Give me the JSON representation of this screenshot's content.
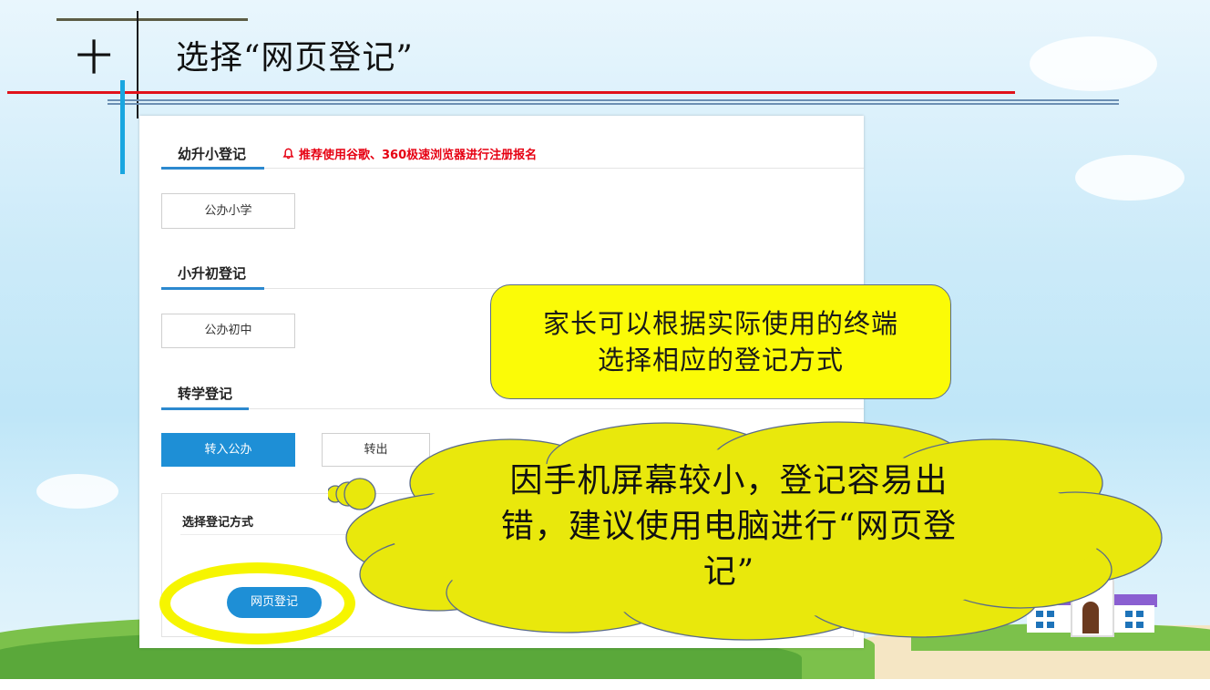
{
  "header": {
    "number": "十",
    "title": "选择“网页登记”"
  },
  "panel": {
    "sections": [
      {
        "title": "幼升小登记",
        "buttons": [
          "公办小学"
        ]
      },
      {
        "title": "小升初登记",
        "buttons": [
          "公办初中"
        ]
      },
      {
        "title": "转学登记",
        "buttons": [
          "转入公办",
          "转出"
        ]
      }
    ],
    "notice": "推荐使用谷歌、360极速浏览器进行注册报名",
    "mode_title": "选择登记方式",
    "web_button": "网页登记"
  },
  "callout_box": {
    "line1": "家长可以根据实际使用的终端",
    "line2": "选择相应的登记方式"
  },
  "cloud_callout": {
    "line1": "因手机屏幕较小，登记容易出",
    "line2": "错，建议使用电脑进行“网页登",
    "line3": "记”"
  },
  "colors": {
    "accent_blue": "#1e8fd6",
    "notice_red": "#e60012",
    "callout_yellow": "#fbfb07",
    "highlight_yellow": "#f6f500"
  }
}
